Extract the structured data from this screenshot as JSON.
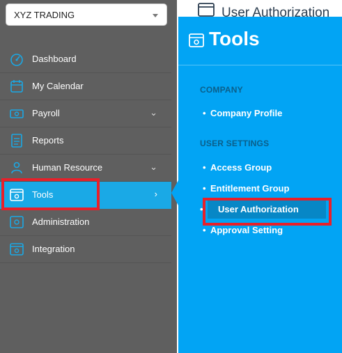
{
  "company_selector": {
    "value": "XYZ TRADING"
  },
  "sidebar": {
    "items": [
      {
        "label": "Dashboard",
        "icon": "dashboard-gauge-icon",
        "has_chevron": false
      },
      {
        "label": "My Calendar",
        "icon": "calendar-icon",
        "has_chevron": false
      },
      {
        "label": "Payroll",
        "icon": "payroll-money-icon",
        "has_chevron": true,
        "chevron": "⌄"
      },
      {
        "label": "Reports",
        "icon": "reports-document-icon",
        "has_chevron": false
      },
      {
        "label": "Human Resource",
        "icon": "human-resource-icon",
        "has_chevron": true,
        "chevron": "⌄"
      },
      {
        "label": "Tools",
        "icon": "tools-icon",
        "has_chevron": true,
        "chevron": "›",
        "active": true
      },
      {
        "label": "Administration",
        "icon": "administration-icon",
        "has_chevron": false
      },
      {
        "label": "Integration",
        "icon": "integration-icon",
        "has_chevron": false
      }
    ]
  },
  "background_page": {
    "title": "User Authorization"
  },
  "tools_panel": {
    "title": "Tools",
    "sections": [
      {
        "heading": "COMPANY",
        "links": [
          "Company Profile"
        ]
      },
      {
        "heading": "USER SETTINGS",
        "links": [
          "Access Group",
          "Entitlement Group",
          "User Authorization",
          "Approval Setting"
        ]
      }
    ],
    "highlighted_link": "User Authorization"
  },
  "colors": {
    "sidebar_bg": "#5f5f5f",
    "active_item": "#1aa9e6",
    "panel_bg": "#02a4f4",
    "section_heading": "#0b5f8a",
    "annotation_red": "#e8202a"
  }
}
